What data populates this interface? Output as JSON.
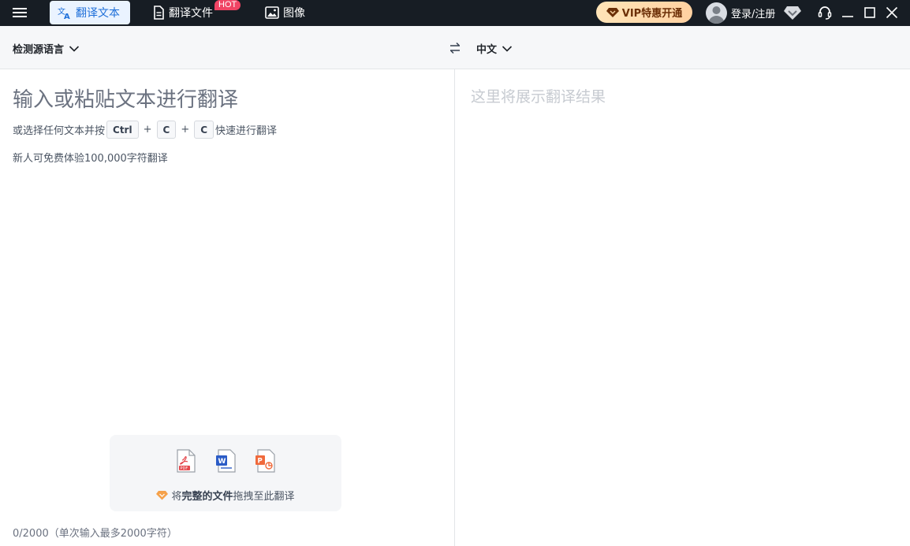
{
  "titlebar": {
    "tabs": [
      {
        "label": "翻译文本",
        "active": true
      },
      {
        "label": "翻译文件",
        "badge": "HOT"
      },
      {
        "label": "图像"
      }
    ],
    "vip_label": "VIP特惠开通",
    "login_label": "登录/注册"
  },
  "langbar": {
    "source_lang": "检测源语言",
    "target_lang": "中文"
  },
  "source": {
    "placeholder": "输入或粘贴文本进行翻译",
    "hint_prefix": "或选择任何文本并按",
    "keys": [
      "Ctrl",
      "C",
      "C"
    ],
    "plus": "+",
    "hint_suffix": "快速进行翻译",
    "promo": "新人可免费体验100,000字符翻译",
    "drop_prefix": "将",
    "drop_bold": "完整的文件",
    "drop_suffix": "拖拽至此翻译",
    "char_count": "0/2000（单次输入最多2000字符）"
  },
  "target": {
    "placeholder": "这里将展示翻译结果"
  },
  "colors": {
    "titlebar_bg": "#171d24",
    "accent": "#1e6fd9",
    "hot": "#f04464",
    "vip_text": "#6b2f07"
  }
}
